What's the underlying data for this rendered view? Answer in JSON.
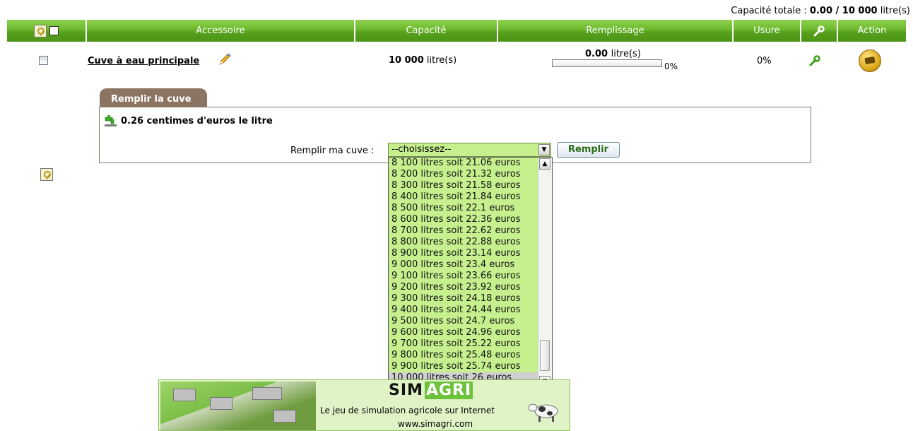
{
  "capacity_total": {
    "label": "Capacité totale :",
    "value": "0.00 / 10 000",
    "unit": "litre(s)"
  },
  "table": {
    "headers": [
      "Accessoire",
      "Capacité",
      "Remplissage",
      "Usure",
      "Action"
    ],
    "row": {
      "name": "Cuve à eau principale",
      "capacity_value": "10 000",
      "capacity_unit": "litre(s)",
      "fill_value": "0.00",
      "fill_unit": "litre(s)",
      "fill_percent_label": "0%",
      "fill_fraction": 0,
      "usure": "0%"
    }
  },
  "fill_panel": {
    "tab_label": "Remplir la cuve",
    "price_text": "0.26 centimes d'euros le litre",
    "select_label": "Remplir ma cuve :",
    "select_value": "--choisissez--",
    "button_label": "Remplir"
  },
  "dropdown_options": [
    "8 100 litres soit 21.06 euros",
    "8 200 litres soit 21.32 euros",
    "8 300 litres soit 21.58 euros",
    "8 400 litres soit 21.84 euros",
    "8 500 litres soit 22.1 euros",
    "8 600 litres soit 22.36 euros",
    "8 700 litres soit 22.62 euros",
    "8 800 litres soit 22.88 euros",
    "8 900 litres soit 23.14 euros",
    "9 000 litres soit 23.4 euros",
    "9 100 litres soit 23.66 euros",
    "9 200 litres soit 23.92 euros",
    "9 300 litres soit 24.18 euros",
    "9 400 litres soit 24.44 euros",
    "9 500 litres soit 24.7 euros",
    "9 600 litres soit 24.96 euros",
    "9 700 litres soit 25.22 euros",
    "9 800 litres soit 25.48 euros",
    "9 900 litres soit 25.74 euros",
    "10 000 litres soit 26 euros"
  ],
  "banner": {
    "logo_left": "SIM",
    "logo_right": "AGRI",
    "tagline": "Le jeu de simulation agricole sur Internet",
    "url": "www.simagri.com"
  },
  "colors": {
    "header_green": "#6cb82c",
    "select_green": "#c6f08e",
    "tab_brown": "#8b7462"
  }
}
